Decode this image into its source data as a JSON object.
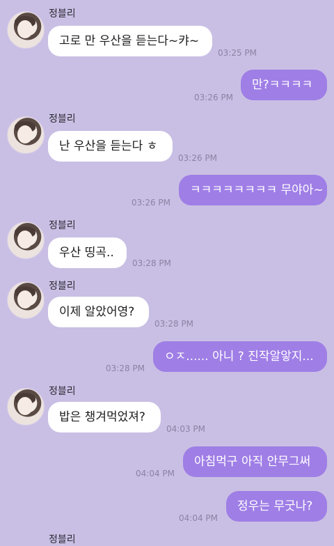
{
  "contact_name": "정블리",
  "messages": [
    {
      "text": "고로 만 우산을 듣는다~캬~",
      "time": "03:25 PM"
    },
    {
      "text": "만?ㅋㅋㅋㅋ",
      "time": "03:26 PM"
    },
    {
      "text": "난 우산을 듣는다 ㅎ",
      "time": "03:26 PM"
    },
    {
      "text": "ㅋㅋㅋㅋㅋㅋㅋㅋ 무야아~",
      "time": "03:26 PM"
    },
    {
      "text": "우산 띵곡..",
      "time": "03:28 PM"
    },
    {
      "text": "이제 알았어영?",
      "time": "03:28 PM"
    },
    {
      "text": "ㅇㅈ...... 아니 ? 진작알앟지...",
      "time": "03:28 PM"
    },
    {
      "text": "밥은 챙겨먹었져?",
      "time": "04:03 PM"
    },
    {
      "text": "아침먹구 아직 안무그써",
      "time": "04:04 PM"
    },
    {
      "text": "정우는 무굿나?",
      "time": "04:04 PM"
    }
  ]
}
